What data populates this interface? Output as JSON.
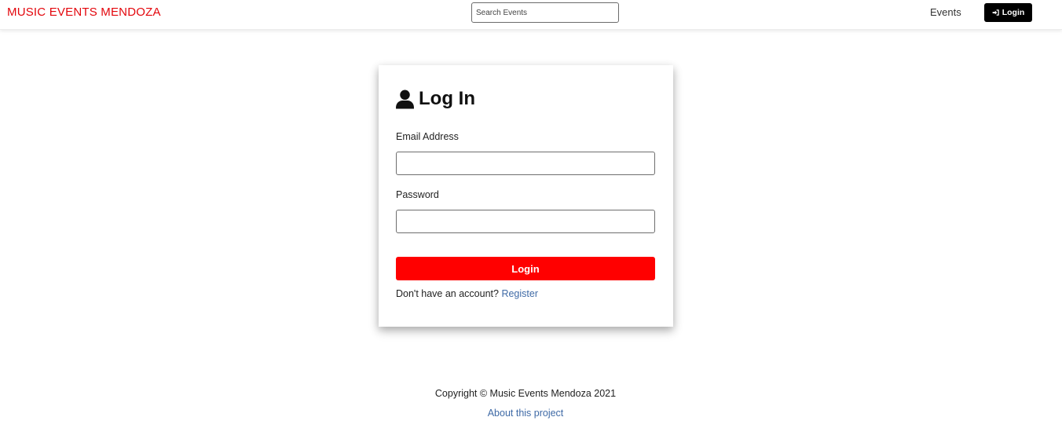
{
  "header": {
    "brand": "MUSIC EVENTS MENDOZA",
    "search_placeholder": "Search Events",
    "nav_events": "Events",
    "nav_login": "Login"
  },
  "login_card": {
    "title": "Log In",
    "email_label": "Email Address",
    "email_value": "",
    "password_label": "Password",
    "password_value": "",
    "submit_label": "Login",
    "no_account_text": "Don't have an account?",
    "register_link": "Register"
  },
  "footer": {
    "copyright": "Copyright © Music Events Mendoza 2021",
    "about_link": "About this project"
  },
  "colors": {
    "brand": "#e3060c",
    "primary_button": "#ff0000",
    "nav_login_bg": "#000000",
    "link": "#3f6aa6"
  },
  "icons": {
    "title_icon": "user-icon",
    "nav_login_icon": "sign-in-icon"
  }
}
